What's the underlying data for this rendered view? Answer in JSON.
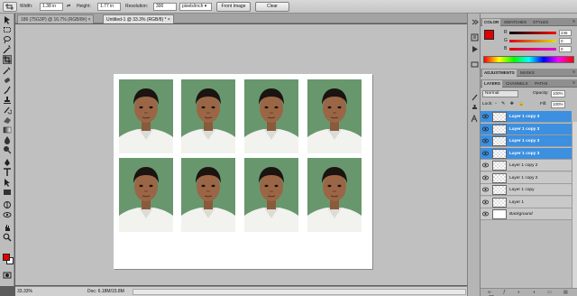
{
  "options_bar": {
    "width_label": "Width:",
    "width_value": "1.38 in",
    "height_label": "Height:",
    "height_value": "1.77 in",
    "resolution_label": "Resolution:",
    "resolution_value": "300",
    "resolution_unit": "pixels/inch",
    "front_image_label": "Front Image",
    "clear_label": "Clear"
  },
  "tabs": [
    {
      "label": "186 (75G3P) @ 16.7% (RGB/8#)"
    },
    {
      "label": "Untitled-1 @ 33.3% (RGB/8) *"
    }
  ],
  "status": {
    "zoom": "33.33%",
    "doc": "Doc: 6.18M/15.8M"
  },
  "color_panel": {
    "tabs": [
      "COLOR",
      "SWATCHES",
      "STYLES"
    ],
    "r_label": "R",
    "r_value": "246",
    "g_label": "G",
    "g_value": "0",
    "b_label": "B",
    "b_value": "0",
    "accent": "#e00000"
  },
  "adjust_panel": {
    "tabs": [
      "ADJUSTMENTS",
      "MASKS"
    ]
  },
  "layers_panel": {
    "tabs": [
      "LAYERS",
      "CHANNELS",
      "PATHS"
    ],
    "blend_mode": "Normal",
    "opacity_label": "Opacity:",
    "opacity_value": "100%",
    "lock_label": "Lock:",
    "fill_label": "Fill:",
    "fill_value": "100%",
    "layers": [
      {
        "name": "Layer 1 copy 3",
        "selected": true
      },
      {
        "name": "Layer 1 copy 3",
        "selected": true
      },
      {
        "name": "Layer 1 copy 3",
        "selected": true
      },
      {
        "name": "Layer 1 copy 3",
        "selected": true
      },
      {
        "name": "Layer 1 copy 2",
        "selected": false
      },
      {
        "name": "Layer 1 copy 2",
        "selected": false
      },
      {
        "name": "Layer 1 copy",
        "selected": false
      },
      {
        "name": "Layer 1",
        "selected": false
      },
      {
        "name": "Background",
        "selected": false
      }
    ]
  },
  "colors": {
    "selection": "#3d8fe0",
    "foreground": "#e00000",
    "background": "#ffffff"
  }
}
